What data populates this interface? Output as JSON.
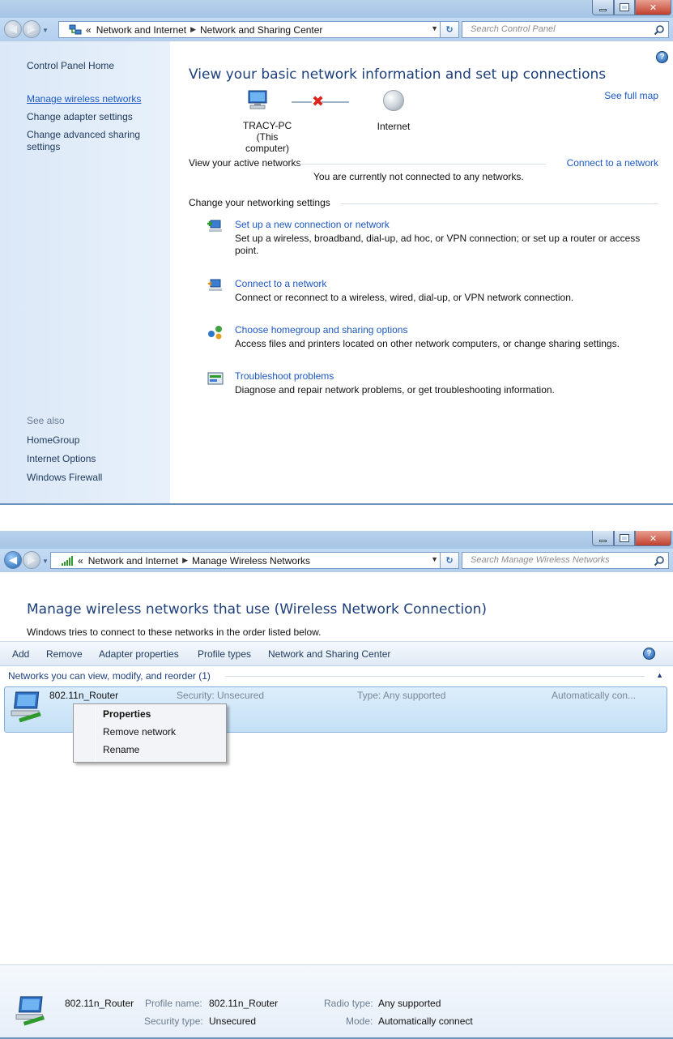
{
  "window1": {
    "breadcrumb": [
      "«",
      "Network and Internet",
      "Network and Sharing Center"
    ],
    "search_placeholder": "Search Control Panel",
    "sidebar": {
      "items": [
        "Control Panel Home",
        "Manage wireless networks",
        "Change adapter settings",
        "Change advanced sharing settings"
      ],
      "see_also_label": "See also",
      "see_also_items": [
        "HomeGroup",
        "Internet Options",
        "Windows Firewall"
      ]
    },
    "main": {
      "heading": "View your basic network information and set up connections",
      "see_full_map": "See full map",
      "computer_name": "TRACY-PC",
      "computer_sub": "(This computer)",
      "internet_label": "Internet",
      "active_networks_label": "View your active networks",
      "connect_link": "Connect to a network",
      "not_connected_text": "You are currently not connected to any networks.",
      "change_settings_label": "Change your networking settings",
      "tasks": [
        {
          "title": "Set up a new connection or network",
          "desc": "Set up a wireless, broadband, dial-up, ad hoc, or VPN connection; or set up a router or access point.",
          "icon": "new-connection-icon"
        },
        {
          "title": "Connect to a network",
          "desc": "Connect or reconnect to a wireless, wired, dial-up, or VPN network connection.",
          "icon": "connect-network-icon"
        },
        {
          "title": "Choose homegroup and sharing options",
          "desc": "Access files and printers located on other network computers, or change sharing settings.",
          "icon": "homegroup-icon"
        },
        {
          "title": "Troubleshoot problems",
          "desc": "Diagnose and repair network problems, or get troubleshooting information.",
          "icon": "troubleshoot-icon"
        }
      ]
    }
  },
  "window2": {
    "breadcrumb": [
      "«",
      "Network and Internet",
      "Manage Wireless Networks"
    ],
    "search_placeholder": "Search Manage Wireless Networks",
    "title": "Manage wireless networks that use (Wireless Network Connection)",
    "subtitle": "Windows tries to connect to these networks in the order listed below.",
    "toolbar": [
      "Add",
      "Remove",
      "Adapter properties",
      "Profile types",
      "Network and Sharing Center"
    ],
    "group_header": "Networks you can view, modify, and reorder (1)",
    "network": {
      "name": "802.11n_Router",
      "security": "Security: Unsecured",
      "type": "Type: Any supported",
      "mode": "Automatically con..."
    },
    "context_menu": [
      "Properties",
      "Remove network",
      "Rename"
    ],
    "details": {
      "name": "802.11n_Router",
      "profile_name_label": "Profile name:",
      "profile_name_value": "802.11n_Router",
      "security_type_label": "Security type:",
      "security_type_value": "Unsecured",
      "radio_type_label": "Radio type:",
      "radio_type_value": "Any supported",
      "mode_label": "Mode:",
      "mode_value": "Automatically connect"
    }
  },
  "colors": {
    "link": "#1c57c3",
    "heading": "#1e3f7a",
    "sidebar_bg": "#dbe8f7",
    "selection": "#c4e0f6",
    "error": "#d9251d"
  }
}
